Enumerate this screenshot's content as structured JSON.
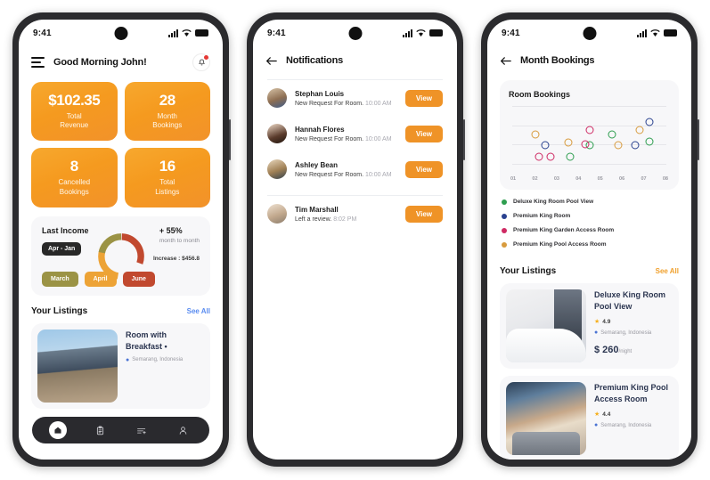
{
  "statusbar": {
    "time": "9:41"
  },
  "phone1": {
    "header": {
      "greeting": "Good Morning John!",
      "menu_icon": "hamburger-icon",
      "bell_icon": "bell-icon"
    },
    "stats": [
      {
        "value": "$102.35",
        "label": "Total\nRevenue"
      },
      {
        "value": "28",
        "label": "Month\nBookings"
      },
      {
        "value": "8",
        "label": "Cancelled\nBookings"
      },
      {
        "value": "16",
        "label": "Total\nListings"
      }
    ],
    "income": {
      "title": "Last Income",
      "percent": "+ 55%",
      "subtitle": "month to month",
      "range_chip": "Apr - Jan",
      "increase": "Increase : $456.8",
      "buttons": [
        {
          "label": "March",
          "color": "#9b9345"
        },
        {
          "label": "April",
          "color": "#eda336"
        },
        {
          "label": "June",
          "color": "#c1492f"
        }
      ],
      "donut_segments": [
        {
          "name": "june",
          "color": "#c1492f",
          "pct": 30
        },
        {
          "name": "april",
          "color": "#eda336",
          "pct": 32
        },
        {
          "name": "march",
          "color": "#9b9345",
          "pct": 23
        }
      ]
    },
    "listings_section": {
      "title": "Your Listings",
      "see_all": "See All"
    },
    "listing": {
      "title": "Room with Breakfast •",
      "location": "Semarang, Indonesia",
      "image": "house-exterior-photo"
    },
    "bottom_nav": [
      {
        "icon": "home-icon",
        "active": true
      },
      {
        "icon": "clipboard-icon",
        "active": false
      },
      {
        "icon": "list-add-icon",
        "active": false
      },
      {
        "icon": "person-icon",
        "active": false
      }
    ]
  },
  "phone2": {
    "header": {
      "back_icon": "back-arrow-icon",
      "title": "Notifications"
    },
    "notifications": [
      {
        "name": "Stephan Louis",
        "message": "New Request For Room.",
        "time": "10:00 AM",
        "action": "View",
        "avatar": "avatar-stephan"
      },
      {
        "name": "Hannah Flores",
        "message": "New Request For Room.",
        "time": "10:00 AM",
        "action": "View",
        "avatar": "avatar-hannah"
      },
      {
        "name": "Ashley Bean",
        "message": "New Request For Room.",
        "time": "10:00 AM",
        "action": "View",
        "avatar": "avatar-ashley"
      },
      {
        "name": "Tim Marshall",
        "message": "Left a review.",
        "time": "8:02 PM",
        "action": "View",
        "avatar": "avatar-tim"
      }
    ]
  },
  "phone3": {
    "header": {
      "back_icon": "back-arrow-icon",
      "title": "Month Bookings"
    },
    "legend": [
      {
        "label": "Deluxe King Room Pool View",
        "color": "#2e9e4f"
      },
      {
        "label": "Premium King Room",
        "color": "#29418f"
      },
      {
        "label": "Premium King Garden Access Room",
        "color": "#cf2a63"
      },
      {
        "label": "Premium King Pool Access Room",
        "color": "#d89b3e"
      }
    ],
    "listings_section": {
      "title": "Your Listings",
      "see_all": "See All"
    },
    "listings": [
      {
        "title": "Deluxe King Room Pool View",
        "rating": "4.9",
        "location": "Semarang, Indonesia",
        "price": "$ 260",
        "price_unit": "/night",
        "image": "bedroom-photo"
      },
      {
        "title": "Premium King Pool Access Room",
        "rating": "4.4",
        "location": "Semarang, Indonesia",
        "price": "",
        "price_unit": "",
        "image": "window-lounge-photo"
      }
    ],
    "chart_data": {
      "type": "scatter",
      "title": "Room Bookings",
      "xlabel": "",
      "ylabel": "",
      "categories": [
        "01",
        "02",
        "03",
        "04",
        "05",
        "06",
        "07",
        "08"
      ],
      "xlim": [
        0.5,
        8.5
      ],
      "ylim": [
        0,
        5
      ],
      "grid": true,
      "legend_position": "below",
      "series": [
        {
          "name": "Deluxe King Room Pool View",
          "color": "#2e9e4f",
          "points": [
            [
              3.5,
              1.1
            ],
            [
              4.5,
              1.9
            ],
            [
              5.7,
              2.7
            ],
            [
              7.6,
              2.2
            ]
          ]
        },
        {
          "name": "Premium King Room",
          "color": "#29418f",
          "points": [
            [
              2.2,
              1.9
            ],
            [
              6.9,
              1.9
            ],
            [
              7.6,
              3.6
            ]
          ]
        },
        {
          "name": "Premium King Garden Access Room",
          "color": "#cf2a63",
          "points": [
            [
              1.9,
              1.1
            ],
            [
              2.5,
              1.1
            ],
            [
              4.3,
              2.0
            ],
            [
              4.5,
              3.0
            ]
          ]
        },
        {
          "name": "Premium King Pool Access Room",
          "color": "#d89b3e",
          "points": [
            [
              1.7,
              2.7
            ],
            [
              3.4,
              2.1
            ],
            [
              6.0,
              1.9
            ],
            [
              7.1,
              3.0
            ]
          ]
        }
      ]
    }
  }
}
